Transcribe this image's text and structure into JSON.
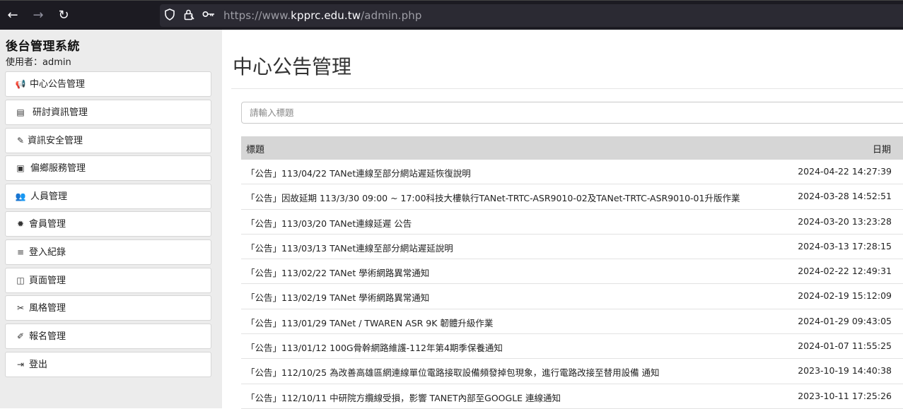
{
  "browser": {
    "back_icon": "←",
    "forward_icon": "→",
    "reload_icon": "↻",
    "url_prefix": "https://www.",
    "url_host": "kpprc.edu.tw",
    "url_path": "/admin.php"
  },
  "sidebar": {
    "title": "後台管理系統",
    "user": "使用者：admin",
    "items": [
      {
        "label": "中心公告管理",
        "icon": "📢"
      },
      {
        "label": "研討資訊管理",
        "icon": "▤"
      },
      {
        "label": "資訊安全管理",
        "icon": "✎"
      },
      {
        "label": "偏鄉服務管理",
        "icon": "▣"
      },
      {
        "label": "人員管理",
        "icon": "👥"
      },
      {
        "label": "會員管理",
        "icon": "✹"
      },
      {
        "label": "登入紀錄",
        "icon": "≡"
      },
      {
        "label": "頁面管理",
        "icon": "◫"
      },
      {
        "label": "風格管理",
        "icon": "✂"
      },
      {
        "label": "報名管理",
        "icon": "✐"
      },
      {
        "label": "登出",
        "icon": "⇥"
      }
    ]
  },
  "main": {
    "page_title": "中心公告管理",
    "search_placeholder": "請輸入標題",
    "table": {
      "col_title": "標題",
      "col_date": "日期",
      "rows": [
        {
          "title": "「公告」113/04/22 TANet連線至部分網站遲延恢復說明",
          "date": "2024-04-22 14:27:39"
        },
        {
          "title": "「公告」因故延期 113/3/30 09:00 ~ 17:00科技大樓執行TANet-TRTC-ASR9010-02及TANet-TRTC-ASR9010-01升版作業",
          "date": "2024-03-28 14:52:51"
        },
        {
          "title": "「公告」113/03/20 TANet連線延遲 公告",
          "date": "2024-03-20 13:23:28"
        },
        {
          "title": "「公告」113/03/13 TANet連線至部分網站遲延說明",
          "date": "2024-03-13 17:28:15"
        },
        {
          "title": "「公告」113/02/22 TANet 學術網路異常通知",
          "date": "2024-02-22 12:49:31"
        },
        {
          "title": "「公告」113/02/19 TANet 學術網路異常通知",
          "date": "2024-02-19 15:12:09"
        },
        {
          "title": "「公告」113/01/29 TANet / TWAREN ASR 9K 韌體升級作業",
          "date": "2024-01-29 09:43:05"
        },
        {
          "title": "「公告」113/01/12 100G骨幹網路維護-112年第4期季保養通知",
          "date": "2024-01-07 11:55:25"
        },
        {
          "title": "「公告」112/10/25 為改善高雄區網連線單位電路接取設備頻發掉包現象，進行電路改接至替用設備 通知",
          "date": "2023-10-19 14:40:38"
        },
        {
          "title": "「公告」112/10/11 中研院方纜線受損，影響 TANET內部至GOOGLE 連線通知",
          "date": "2023-10-11 17:25:26"
        }
      ]
    }
  }
}
